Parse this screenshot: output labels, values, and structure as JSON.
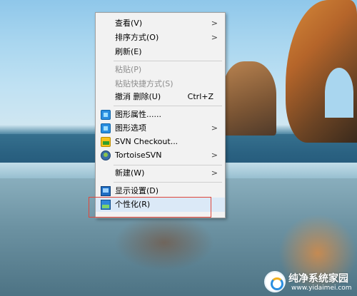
{
  "context_menu": {
    "items": [
      {
        "label": "查看(V)",
        "submenu": true,
        "enabled": true,
        "icon": ""
      },
      {
        "label": "排序方式(O)",
        "submenu": true,
        "enabled": true,
        "icon": ""
      },
      {
        "label": "刷新(E)",
        "submenu": false,
        "enabled": true,
        "icon": ""
      },
      {
        "label": "粘贴(P)",
        "submenu": false,
        "enabled": false,
        "icon": ""
      },
      {
        "label": "粘贴快捷方式(S)",
        "submenu": false,
        "enabled": false,
        "icon": ""
      },
      {
        "label": "撤消 删除(U)",
        "shortcut": "Ctrl+Z",
        "submenu": false,
        "enabled": true,
        "icon": ""
      },
      {
        "label": "图形属性......",
        "submenu": false,
        "enabled": true,
        "icon": "graphics-properties-icon"
      },
      {
        "label": "图形选项",
        "submenu": true,
        "enabled": true,
        "icon": "graphics-options-icon"
      },
      {
        "label": "SVN Checkout...",
        "submenu": false,
        "enabled": true,
        "icon": "svn-checkout-icon"
      },
      {
        "label": "TortoiseSVN",
        "submenu": true,
        "enabled": true,
        "icon": "tortoisesvn-icon"
      },
      {
        "label": "新建(W)",
        "submenu": true,
        "enabled": true,
        "icon": ""
      },
      {
        "label": "显示设置(D)",
        "submenu": false,
        "enabled": true,
        "icon": "display-settings-icon"
      },
      {
        "label": "个性化(R)",
        "submenu": false,
        "enabled": true,
        "icon": "personalize-icon"
      }
    ],
    "arrow_glyph": ">"
  },
  "watermark": {
    "title": "纯净系统家园",
    "url": "www.yidaimei.com"
  },
  "colors": {
    "menu_bg": "#f2f2f2",
    "highlight_border": "#e0463a",
    "disabled_text": "#8d8d8d"
  }
}
